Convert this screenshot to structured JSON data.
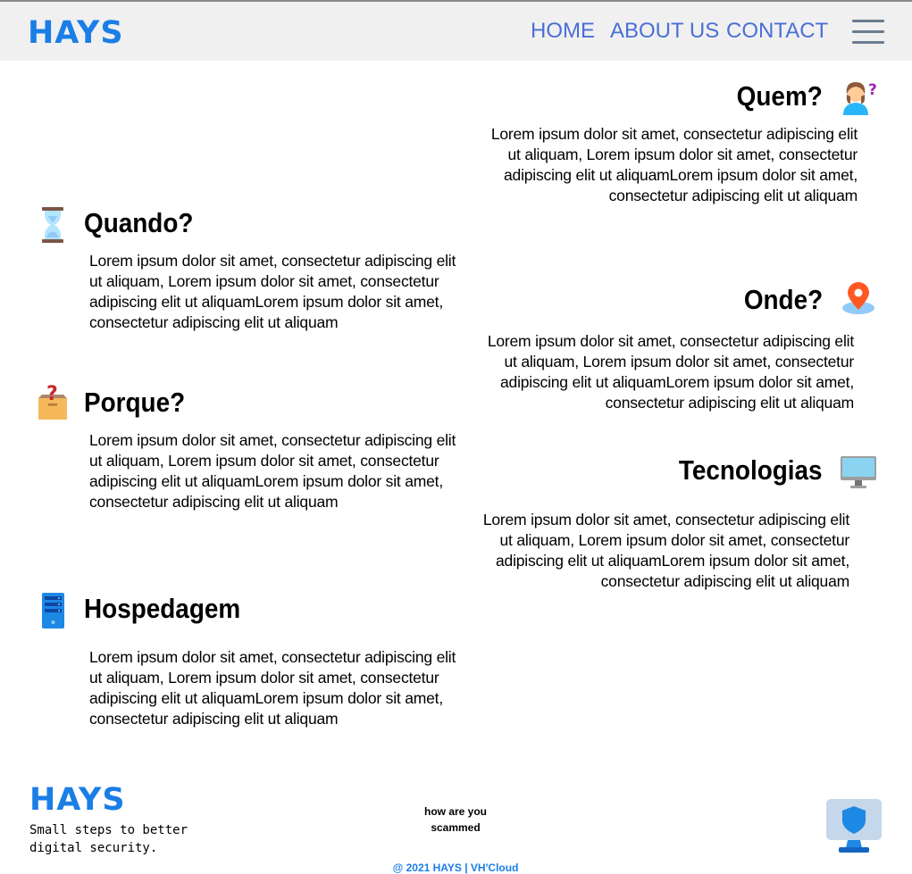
{
  "navbar": {
    "brand": "HAYS",
    "links": [
      "HOME",
      "ABOUT US",
      "CONTACT"
    ],
    "menu_icon": "hamburger-menu-icon"
  },
  "sections": {
    "quem": {
      "title": "Quem?",
      "icon": "person-question-icon",
      "text": "Lorem ipsum dolor sit amet, consectetur adipiscing elit ut aliquam, Lorem ipsum dolor sit amet, consectetur adipiscing elit ut aliquamLorem ipsum dolor sit amet, consectetur adipiscing elit ut aliquam"
    },
    "quando": {
      "title": "Quando?",
      "icon": "hourglass-icon",
      "text": "Lorem ipsum dolor sit amet, consectetur adipiscing elit ut aliquam, Lorem ipsum dolor sit amet, consectetur adipiscing elit ut aliquamLorem ipsum dolor sit amet, consectetur adipiscing elit ut aliquam"
    },
    "onde": {
      "title": "Onde?",
      "icon": "map-pin-icon",
      "text": "Lorem ipsum dolor sit amet, consectetur adipiscing elit ut aliquam, Lorem ipsum dolor sit amet, consectetur adipiscing elit ut aliquamLorem ipsum dolor sit amet, consectetur adipiscing elit ut aliquam"
    },
    "porque": {
      "title": "Porque?",
      "icon": "question-box-icon",
      "text": "Lorem ipsum dolor sit amet, consectetur adipiscing elit ut aliquam, Lorem ipsum dolor sit amet, consectetur adipiscing elit ut aliquamLorem ipsum dolor sit amet, consectetur adipiscing elit ut aliquam"
    },
    "tecnologias": {
      "title": "Tecnologias",
      "icon": "desktop-computer-icon",
      "text": "Lorem ipsum dolor sit amet, consectetur adipiscing elit ut aliquam, Lorem ipsum dolor sit amet, consectetur adipiscing elit ut aliquamLorem ipsum dolor sit amet, consectetur adipiscing elit ut aliquam"
    },
    "hospedagem": {
      "title": "Hospedagem",
      "icon": "server-icon",
      "text": "Lorem ipsum dolor sit amet, consectetur adipiscing elit ut aliquam, Lorem ipsum dolor sit amet, consectetur adipiscing elit ut aliquamLorem ipsum dolor sit amet, consectetur adipiscing elit ut aliquam"
    }
  },
  "footer": {
    "brand": "HAYS",
    "tagline": "Small steps to better digital security.",
    "phrase": "how are you scammed",
    "copyright": "@ 2021 HAYS | VH'Cloud",
    "icon": "shield-computer-icon"
  },
  "colors": {
    "brand": "#1a7ee6",
    "nav_link": "#4a6fd6",
    "nav_bg": "#f0f0f0"
  }
}
